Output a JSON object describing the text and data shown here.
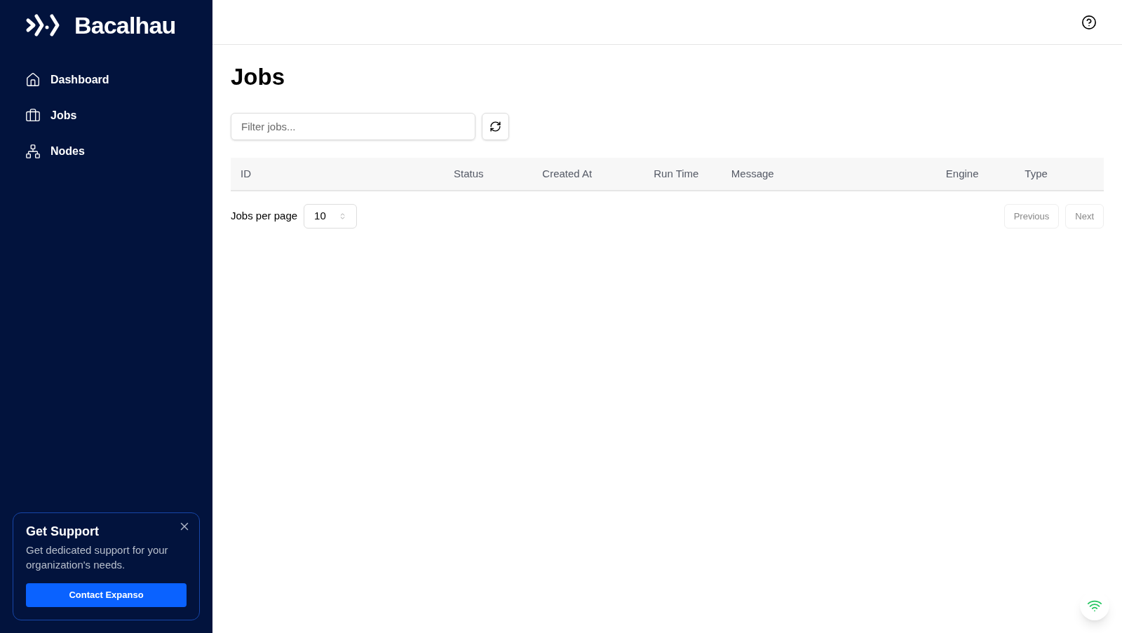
{
  "sidebar": {
    "brand": "Bacalhau",
    "items": [
      {
        "label": "Dashboard"
      },
      {
        "label": "Jobs"
      },
      {
        "label": "Nodes"
      }
    ],
    "support_card": {
      "title": "Get Support",
      "text": "Get dedicated support for your organization's needs.",
      "button": "Contact Expanso"
    }
  },
  "page": {
    "title": "Jobs",
    "filter": {
      "placeholder": "Filter jobs..."
    },
    "table": {
      "columns": [
        {
          "label": "ID"
        },
        {
          "label": "Status"
        },
        {
          "label": "Created At"
        },
        {
          "label": "Run Time"
        },
        {
          "label": "Message"
        },
        {
          "label": "Engine"
        },
        {
          "label": "Type"
        }
      ]
    },
    "pagination": {
      "per_page_label": "Jobs per page",
      "per_page_value": "10",
      "buttons": [
        {
          "label": "Previous",
          "disabled": true
        },
        {
          "label": "Next",
          "disabled": true
        }
      ]
    }
  }
}
